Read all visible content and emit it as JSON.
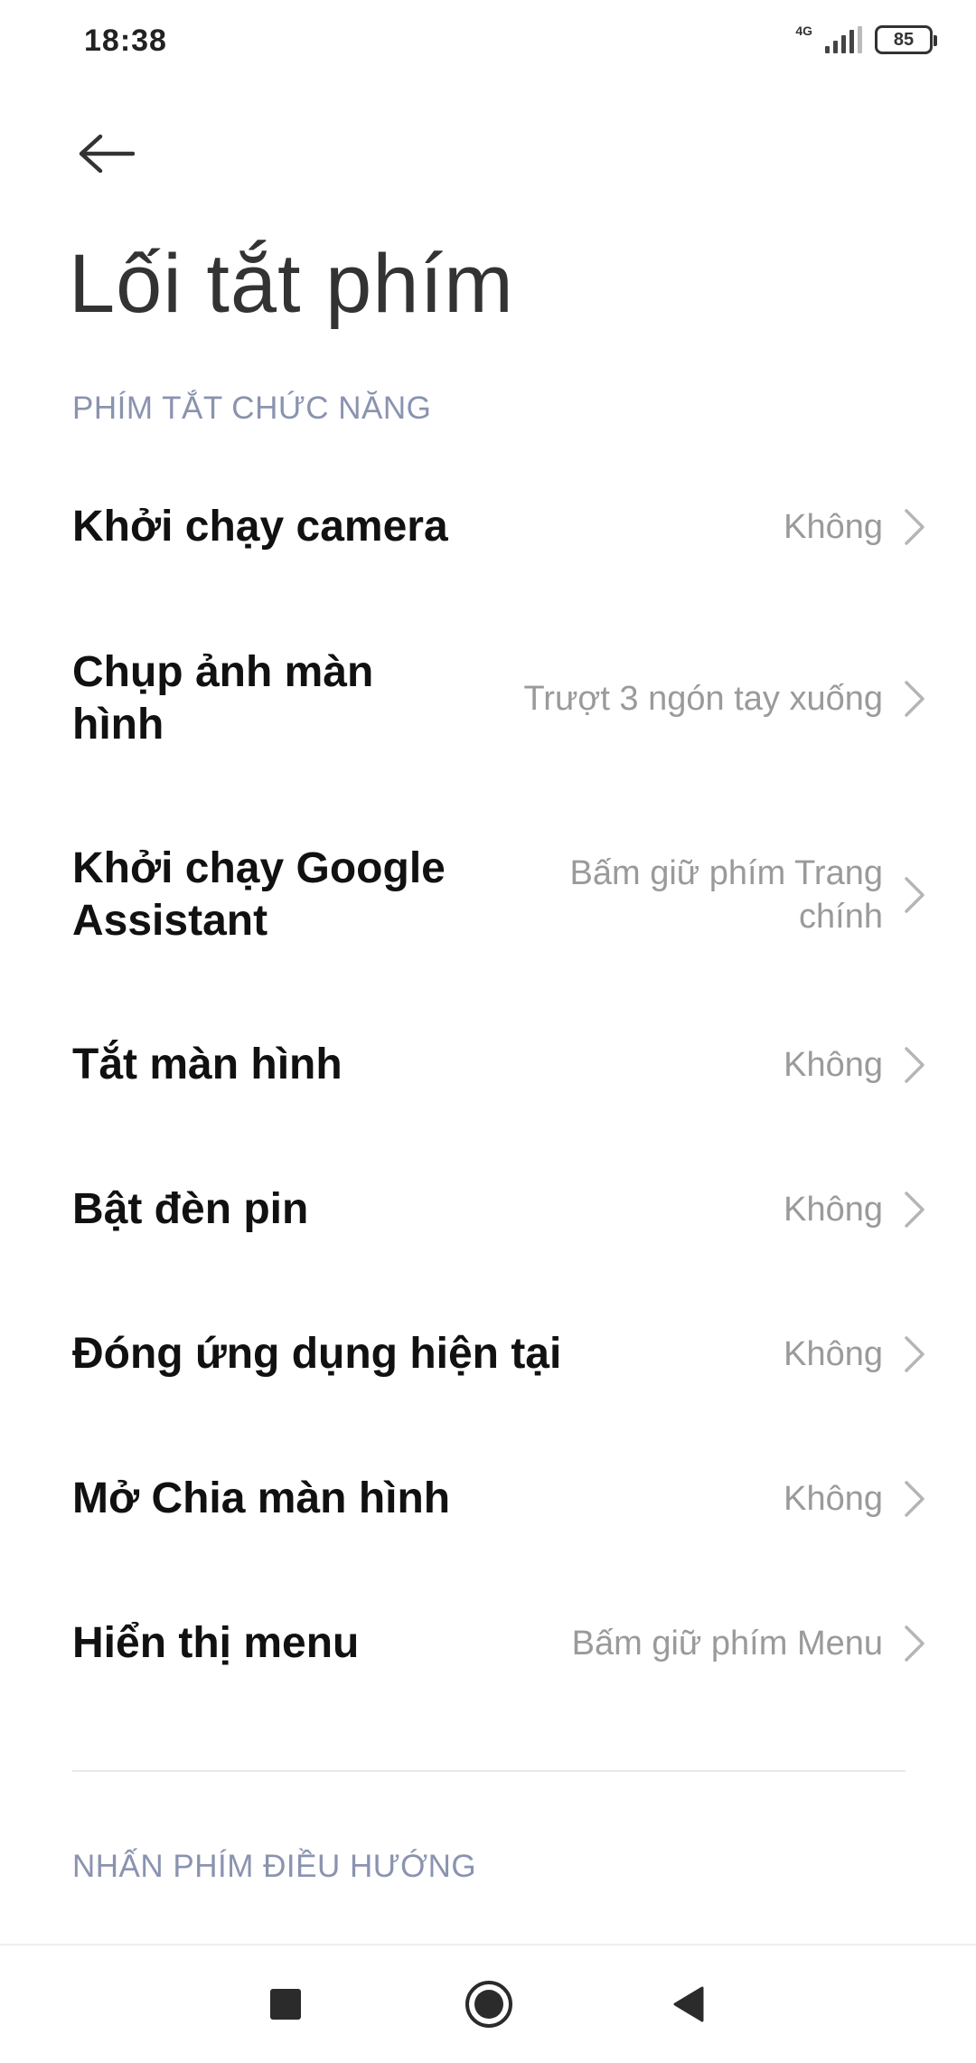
{
  "status_bar": {
    "time": "18:38",
    "network": "4G",
    "battery": "85"
  },
  "header": {
    "back_icon": "arrow-left-icon",
    "title": "Lối tắt phím"
  },
  "section_function": {
    "header": "PHÍM TẮT CHỨC NĂNG",
    "items": [
      {
        "title": "Khởi chạy camera",
        "value": "Không"
      },
      {
        "title": "Chụp ảnh màn\nhình",
        "value": "Trượt 3 ngón tay xuống"
      },
      {
        "title": "Khởi chạy Google\nAssistant",
        "value": "Bấm giữ phím Trang\nchính"
      },
      {
        "title": "Tắt màn hình",
        "value": "Không"
      },
      {
        "title": "Bật đèn pin",
        "value": "Không"
      },
      {
        "title": "Đóng ứng dụng hiện tại",
        "value": "Không"
      },
      {
        "title": "Mở Chia màn hình",
        "value": "Không"
      },
      {
        "title": "Hiển thị menu",
        "value": "Bấm giữ phím Menu"
      }
    ]
  },
  "section_navigation": {
    "header": "NHẤN PHÍM ĐIỀU HƯỚNG"
  },
  "nav_bar": {
    "recents_icon": "square-icon",
    "home_icon": "circle-icon",
    "back_icon": "triangle-back-icon"
  },
  "colors": {
    "section_header": "#8a93b0",
    "value_text": "#9a9a9a",
    "title_text": "#111111"
  }
}
